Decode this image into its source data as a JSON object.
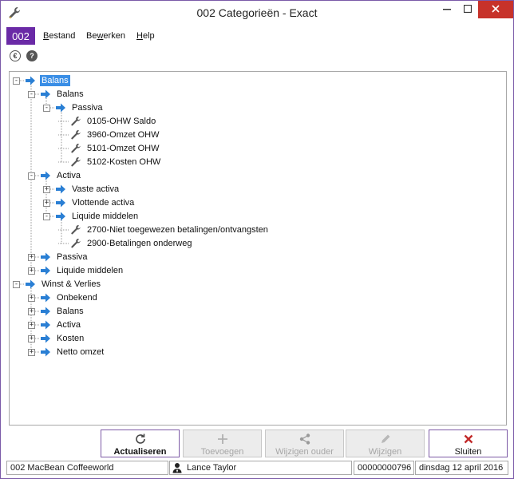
{
  "window": {
    "title": "002 Categorieën - Exact",
    "icons": {
      "app": "wrench-icon",
      "minimize": "minimize-icon",
      "maximize": "maximize-icon",
      "close": "close-icon"
    }
  },
  "menubar": {
    "company_code": "002",
    "items": [
      {
        "label": "Bestand",
        "underline": "B",
        "rest": "estand"
      },
      {
        "label": "Bewerken",
        "underline": "w",
        "pre": "Be",
        "rest": "erken"
      },
      {
        "label": "Help",
        "underline": "H",
        "rest": "elp"
      }
    ]
  },
  "toolbar": {
    "icons": [
      "euro-icon",
      "help-icon"
    ],
    "euro_glyph": "€",
    "help_glyph": "?"
  },
  "tree": {
    "nodes": [
      {
        "label": "Balans",
        "level": 0,
        "expander": "-",
        "icon": "arrow-icon",
        "selected": true
      },
      {
        "label": "Balans",
        "level": 1,
        "expander": "-",
        "icon": "arrow-icon"
      },
      {
        "label": "Passiva",
        "level": 2,
        "expander": "-",
        "icon": "arrow-icon"
      },
      {
        "label": "0105-OHW Saldo",
        "level": 3,
        "expander": "",
        "icon": "wrench-icon"
      },
      {
        "label": "3960-Omzet OHW",
        "level": 3,
        "expander": "",
        "icon": "wrench-icon"
      },
      {
        "label": "5101-Omzet OHW",
        "level": 3,
        "expander": "",
        "icon": "wrench-icon"
      },
      {
        "label": "5102-Kosten OHW",
        "level": 3,
        "expander": "",
        "icon": "wrench-icon"
      },
      {
        "label": "Activa",
        "level": 1,
        "expander": "-",
        "icon": "arrow-icon"
      },
      {
        "label": "Vaste activa",
        "level": 2,
        "expander": "+",
        "icon": "arrow-icon"
      },
      {
        "label": "Vlottende activa",
        "level": 2,
        "expander": "+",
        "icon": "arrow-icon"
      },
      {
        "label": "Liquide middelen",
        "level": 2,
        "expander": "-",
        "icon": "arrow-icon"
      },
      {
        "label": "2700-Niet toegewezen betalingen/ontvangsten",
        "level": 3,
        "expander": "",
        "icon": "wrench-icon"
      },
      {
        "label": "2900-Betalingen onderweg",
        "level": 3,
        "expander": "",
        "icon": "wrench-icon"
      },
      {
        "label": "Passiva",
        "level": 1,
        "expander": "+",
        "icon": "arrow-icon"
      },
      {
        "label": "Liquide middelen",
        "level": 1,
        "expander": "+",
        "icon": "arrow-icon"
      },
      {
        "label": "Winst & Verlies",
        "level": 0,
        "expander": "-",
        "icon": "arrow-icon"
      },
      {
        "label": "Onbekend",
        "level": 1,
        "expander": "+",
        "icon": "arrow-icon"
      },
      {
        "label": "Balans",
        "level": 1,
        "expander": "+",
        "icon": "arrow-icon"
      },
      {
        "label": "Activa",
        "level": 1,
        "expander": "+",
        "icon": "arrow-icon"
      },
      {
        "label": "Kosten",
        "level": 1,
        "expander": "+",
        "icon": "arrow-icon"
      },
      {
        "label": "Netto omzet",
        "level": 1,
        "expander": "+",
        "icon": "arrow-icon"
      }
    ]
  },
  "buttons": [
    {
      "key": "actualiseren",
      "label": "Actualiseren",
      "icon": "refresh-icon",
      "enabled": true,
      "bold": true
    },
    {
      "key": "toevoegen",
      "label": "Toevoegen",
      "icon": "plus-icon",
      "enabled": false,
      "bold": false
    },
    {
      "key": "wijzigen-ouder",
      "label": "Wijzigen ouder",
      "icon": "share-icon",
      "enabled": false,
      "bold": false
    },
    {
      "key": "wijzigen",
      "label": "Wijzigen",
      "icon": "pencil-icon",
      "enabled": false,
      "bold": false
    },
    {
      "key": "sluiten",
      "label": "Sluiten",
      "icon": "close-x-icon",
      "enabled": true,
      "bold": false
    }
  ],
  "statusbar": {
    "company": "002 MacBean Coffeeworld",
    "user": "Lance Taylor",
    "user_icon": "user-icon",
    "number": "00000000796",
    "date": "dinsdag 12 april 2016"
  },
  "colors": {
    "accent": "#6a2aa6",
    "selection": "#3a8ee6",
    "arrow": "#2a7fd4",
    "close": "#c7322a"
  }
}
